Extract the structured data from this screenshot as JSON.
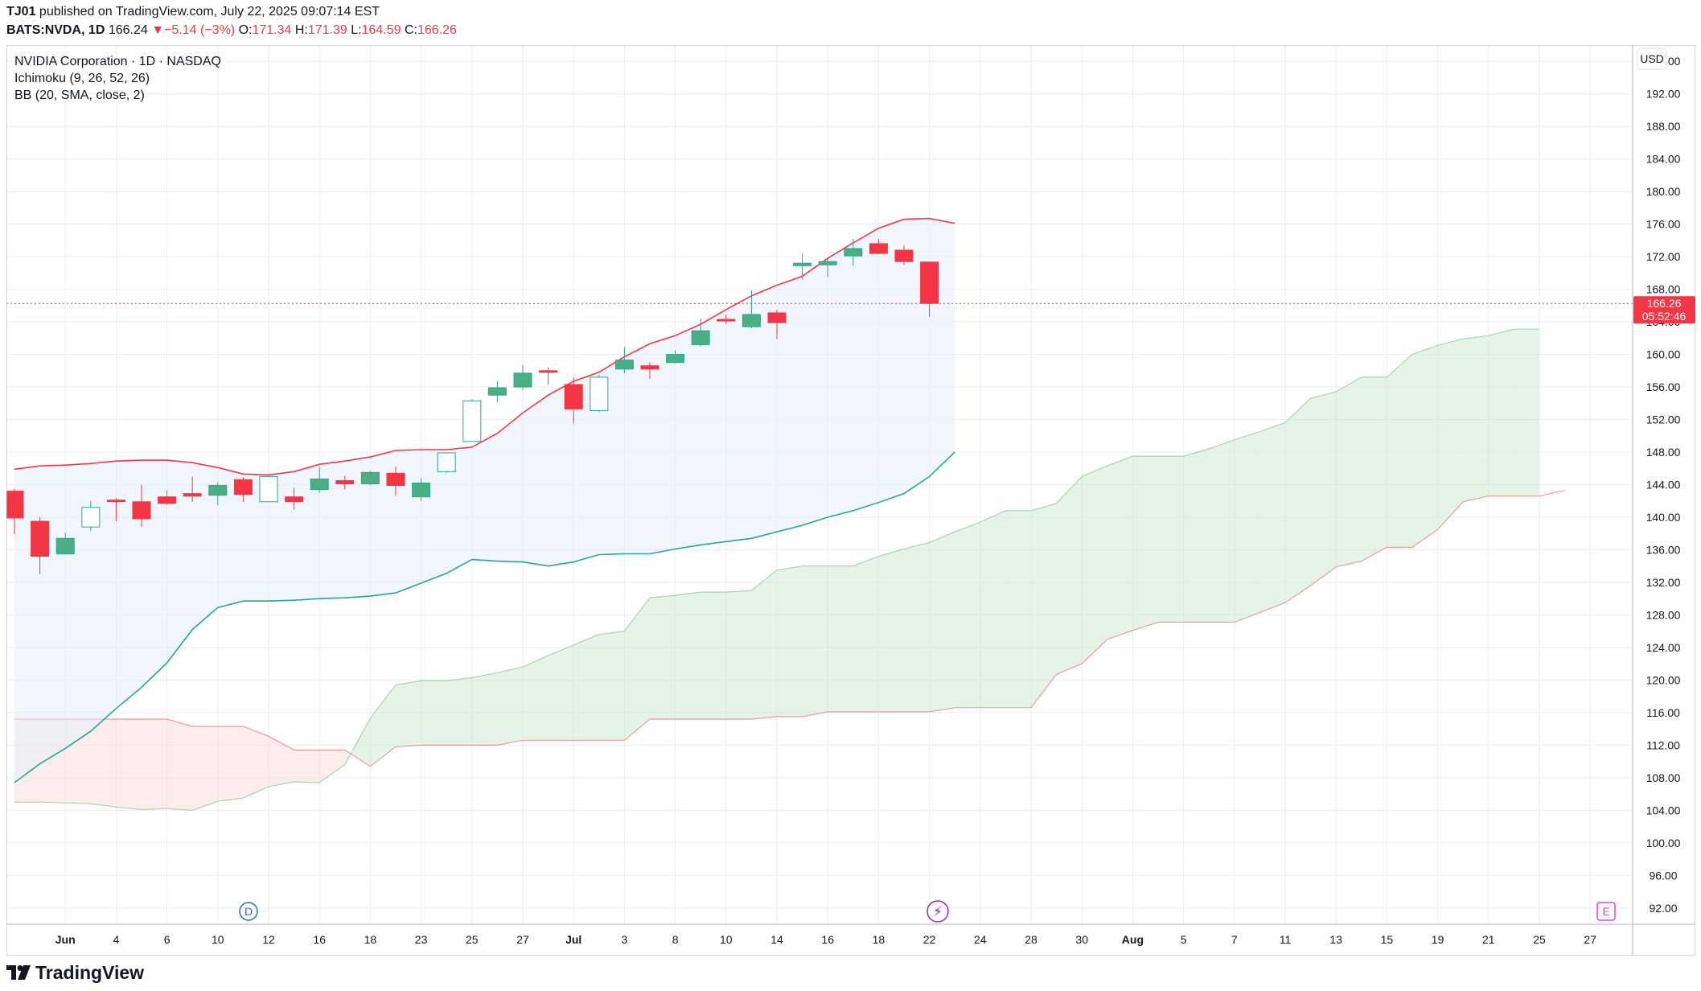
{
  "header": {
    "publisher": "TJ01",
    "published_text": "published on TradingView.com, July 22, 2025 09:07:14 EST",
    "symbol": "BATS:NVDA, 1D",
    "last": "166.24",
    "change": "−5.14 (−3%)",
    "o_label": "O:",
    "o": "171.34",
    "h_label": "H:",
    "h": "171.39",
    "l_label": "L:",
    "l": "164.59",
    "c_label": "C:",
    "c": "166.26"
  },
  "legend": {
    "title": "NVIDIA Corporation · 1D · NASDAQ",
    "ichimoku": "Ichimoku (9, 26, 52, 26)",
    "bb": "BB (20, SMA, close, 2)"
  },
  "price_axis": {
    "currency": "USD",
    "ticks": [
      "92.00",
      "96.00",
      "100.00",
      "104.00",
      "108.00",
      "112.00",
      "116.00",
      "120.00",
      "124.00",
      "128.00",
      "132.00",
      "136.00",
      "140.00",
      "144.00",
      "148.00",
      "152.00",
      "156.00",
      "160.00",
      "164.00",
      "168.00",
      "172.00",
      "176.00",
      "180.00",
      "184.00",
      "188.00",
      "192.00",
      "196.00"
    ],
    "last_price_label": "166.26",
    "countdown_label": "05:52:46"
  },
  "time_axis": {
    "labels": [
      "Jun",
      "4",
      "6",
      "10",
      "12",
      "16",
      "18",
      "23",
      "25",
      "27",
      "Jul",
      "3",
      "8",
      "10",
      "14",
      "16",
      "18",
      "22",
      "24",
      "28",
      "30",
      "Aug",
      "5",
      "7",
      "11",
      "13",
      "15",
      "19",
      "21",
      "25",
      "27"
    ],
    "bold_labels": [
      "Jun",
      "Jul",
      "Aug"
    ]
  },
  "markers": {
    "dividend": "D",
    "earnings": "E"
  },
  "footer": {
    "brand": "TradingView"
  },
  "colors": {
    "up": "#4caf82",
    "up_border": "#26a69a",
    "down": "#f23645",
    "bb_upper": "#f23645",
    "bb_lower": "#26a69a",
    "bb_fill": "#e3eefa",
    "cloud_bull": "#c8e6c9",
    "cloud_bear": "#fad4d4",
    "span_a": "#a5d6a7",
    "span_b": "#ef9a9a",
    "grid": "#e8eef2",
    "last_price_bg": "#f23645"
  },
  "chart_data": {
    "type": "candlestick",
    "title": "NVIDIA Corporation · 1D · NASDAQ",
    "y_range": [
      90,
      198
    ],
    "candles": [
      {
        "date": "May 29",
        "o": 143.2,
        "h": 143.5,
        "l": 137.9,
        "c": 139.9
      },
      {
        "date": "May 30",
        "o": 139.5,
        "h": 140.0,
        "l": 133.0,
        "c": 135.2
      },
      {
        "date": "Jun 2",
        "o": 135.5,
        "h": 138.1,
        "l": 135.4,
        "c": 137.4
      },
      {
        "date": "Jun 3",
        "o": 138.8,
        "h": 142.0,
        "l": 138.3,
        "c": 141.2
      },
      {
        "date": "Jun 4",
        "o": 142.1,
        "h": 142.4,
        "l": 139.5,
        "c": 141.9
      },
      {
        "date": "Jun 5",
        "o": 141.9,
        "h": 144.0,
        "l": 138.8,
        "c": 139.8
      },
      {
        "date": "Jun 6",
        "o": 142.5,
        "h": 143.3,
        "l": 141.5,
        "c": 141.7
      },
      {
        "date": "Jun 9",
        "o": 142.9,
        "h": 145.0,
        "l": 141.9,
        "c": 142.6
      },
      {
        "date": "Jun 10",
        "o": 142.7,
        "h": 144.3,
        "l": 141.5,
        "c": 143.9
      },
      {
        "date": "Jun 11",
        "o": 144.6,
        "h": 144.9,
        "l": 141.9,
        "c": 142.8
      },
      {
        "date": "Jun 12",
        "o": 141.9,
        "h": 145.2,
        "l": 141.9,
        "c": 145.0
      },
      {
        "date": "Jun 13",
        "o": 142.5,
        "h": 143.6,
        "l": 140.9,
        "c": 141.9
      },
      {
        "date": "Jun 16",
        "o": 143.4,
        "h": 146.2,
        "l": 143.0,
        "c": 144.7
      },
      {
        "date": "Jun 17",
        "o": 144.5,
        "h": 145.1,
        "l": 143.4,
        "c": 144.1
      },
      {
        "date": "Jun 18",
        "o": 144.1,
        "h": 145.7,
        "l": 143.9,
        "c": 145.5
      },
      {
        "date": "Jun 20",
        "o": 145.4,
        "h": 146.2,
        "l": 142.6,
        "c": 143.9
      },
      {
        "date": "Jun 23",
        "o": 142.5,
        "h": 144.8,
        "l": 142.0,
        "c": 144.2
      },
      {
        "date": "Jun 24",
        "o": 145.6,
        "h": 147.8,
        "l": 145.4,
        "c": 147.9
      },
      {
        "date": "Jun 25",
        "o": 149.3,
        "h": 154.5,
        "l": 149.3,
        "c": 154.3
      },
      {
        "date": "Jun 26",
        "o": 155.0,
        "h": 156.7,
        "l": 154.1,
        "c": 155.9
      },
      {
        "date": "Jun 27",
        "o": 156.0,
        "h": 158.7,
        "l": 155.6,
        "c": 157.7
      },
      {
        "date": "Jun 30",
        "o": 158.0,
        "h": 158.4,
        "l": 156.3,
        "c": 157.8
      },
      {
        "date": "Jul 1",
        "o": 156.3,
        "h": 157.2,
        "l": 151.5,
        "c": 153.3
      },
      {
        "date": "Jul 2",
        "o": 153.1,
        "h": 157.5,
        "l": 152.9,
        "c": 157.2
      },
      {
        "date": "Jul 3",
        "o": 158.2,
        "h": 160.9,
        "l": 157.7,
        "c": 159.3
      },
      {
        "date": "Jul 7",
        "o": 158.6,
        "h": 159.0,
        "l": 157.0,
        "c": 158.2
      },
      {
        "date": "Jul 8",
        "o": 159.0,
        "h": 160.5,
        "l": 158.9,
        "c": 160.0
      },
      {
        "date": "Jul 9",
        "o": 161.2,
        "h": 164.4,
        "l": 161.0,
        "c": 162.9
      },
      {
        "date": "Jul 10",
        "o": 164.3,
        "h": 164.9,
        "l": 163.7,
        "c": 164.1
      },
      {
        "date": "Jul 11",
        "o": 163.4,
        "h": 167.9,
        "l": 163.2,
        "c": 164.9
      },
      {
        "date": "Jul 14",
        "o": 165.1,
        "h": 165.5,
        "l": 161.9,
        "c": 163.9
      },
      {
        "date": "Jul 15",
        "o": 170.9,
        "h": 172.4,
        "l": 169.2,
        "c": 171.2
      },
      {
        "date": "Jul 16",
        "o": 171.0,
        "h": 171.8,
        "l": 169.5,
        "c": 171.4
      },
      {
        "date": "Jul 17",
        "o": 172.1,
        "h": 174.2,
        "l": 170.9,
        "c": 173.0
      },
      {
        "date": "Jul 18",
        "o": 173.6,
        "h": 174.2,
        "l": 172.3,
        "c": 172.4
      },
      {
        "date": "Jul 21",
        "o": 172.8,
        "h": 173.4,
        "l": 171.0,
        "c": 171.4
      },
      {
        "date": "Jul 22",
        "o": 171.34,
        "h": 171.39,
        "l": 164.59,
        "c": 166.26
      }
    ],
    "bb_upper": [
      145.9,
      146.3,
      146.4,
      146.6,
      146.9,
      147.0,
      147.0,
      146.7,
      146.1,
      145.3,
      145.2,
      145.6,
      146.5,
      146.9,
      147.4,
      148.2,
      148.3,
      148.3,
      148.6,
      150.3,
      152.8,
      155.0,
      156.7,
      157.8,
      159.7,
      161.3,
      162.3,
      163.7,
      165.5,
      167.2,
      168.5,
      169.6,
      171.8,
      173.7,
      175.5,
      176.6,
      176.7,
      176.1
    ],
    "bb_lower": [
      107.4,
      109.7,
      111.6,
      113.7,
      116.5,
      119.1,
      122.1,
      126.2,
      128.9,
      129.7,
      129.7,
      129.8,
      130.0,
      130.1,
      130.3,
      130.7,
      131.9,
      133.1,
      134.8,
      134.6,
      134.5,
      134.0,
      134.5,
      135.4,
      135.5,
      135.5,
      136.1,
      136.6,
      137.0,
      137.4,
      138.2,
      139.0,
      140.0,
      140.8,
      141.8,
      142.9,
      145.0,
      148.0
    ],
    "ichimoku_span_a": [
      105.0,
      105.0,
      104.9,
      104.8,
      104.4,
      104.1,
      104.2,
      104.0,
      105.1,
      105.5,
      106.9,
      107.5,
      107.4,
      109.6,
      115.3,
      119.4,
      119.9,
      119.9,
      120.3,
      120.9,
      121.6,
      123.0,
      124.3,
      125.6,
      126.0,
      130.1,
      130.4,
      130.8,
      130.8,
      131.0,
      133.5,
      134.0,
      134.0,
      134.0,
      135.2,
      136.1,
      136.9,
      138.2,
      139.4,
      140.8,
      140.8,
      141.7,
      145.0,
      146.3,
      147.5,
      147.5,
      147.5,
      148.4,
      149.5,
      150.5,
      151.6,
      154.6,
      155.4,
      157.2,
      157.2,
      160.0,
      161.1,
      161.9,
      162.3,
      163.1,
      163.1
    ],
    "ichimoku_span_b": [
      115.2,
      115.2,
      115.2,
      115.2,
      115.2,
      115.2,
      115.2,
      114.3,
      114.3,
      114.3,
      113.1,
      111.4,
      111.4,
      111.4,
      109.4,
      111.8,
      112.0,
      112.0,
      112.0,
      112.0,
      112.6,
      112.6,
      112.6,
      112.6,
      112.6,
      115.2,
      115.2,
      115.2,
      115.2,
      115.2,
      115.5,
      115.5,
      116.1,
      116.1,
      116.1,
      116.1,
      116.1,
      116.6,
      116.6,
      116.6,
      116.6,
      120.7,
      122.0,
      125.0,
      126.1,
      127.1,
      127.1,
      127.1,
      127.1,
      128.3,
      129.5,
      131.6,
      133.9,
      134.6,
      136.3,
      136.3,
      138.5,
      141.9,
      142.6,
      142.6,
      142.6,
      143.3
    ]
  }
}
